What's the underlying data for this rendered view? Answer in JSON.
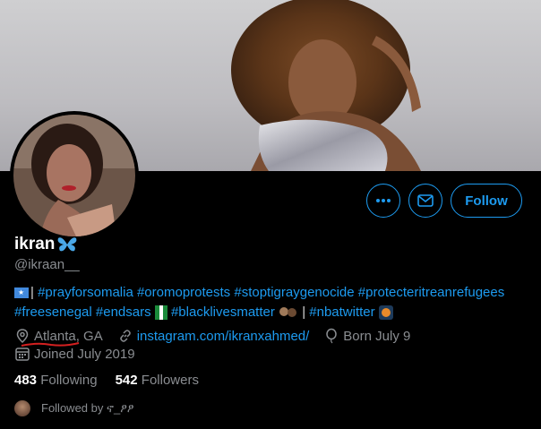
{
  "profile": {
    "name": "ikran",
    "name_emoji": "butterfly-icon",
    "handle": "@ikraan__",
    "bio": {
      "flag": "somalia-flag-icon",
      "sep1": "| ",
      "line1_tags": [
        "#prayforsomalia",
        "#oromoprotests",
        "#stoptigraygenocide",
        "#protecteritreanrefugees"
      ],
      "line2_tags": [
        "#freesenegal",
        "#endsars"
      ],
      "tag_blm": "#blacklivesmatter",
      "sep2": " | ",
      "tag_nba": "#nbatwitter"
    },
    "location": "Atlanta, GA",
    "website": "instagram.com/ikranxahmed/",
    "birthday": "Born July 9",
    "joined": "Joined July 2019",
    "following_count": "483",
    "following_label": "Following",
    "followers_count": "542",
    "followers_label": "Followers",
    "followed_by": "Followed by ኖ_ፆፆ"
  },
  "actions": {
    "more_icon": "more-icon",
    "message_icon": "mail-icon",
    "follow_label": "Follow"
  },
  "colors": {
    "accent": "#1d9bf0",
    "background": "#000000",
    "secondary_text": "#8a8d91"
  }
}
